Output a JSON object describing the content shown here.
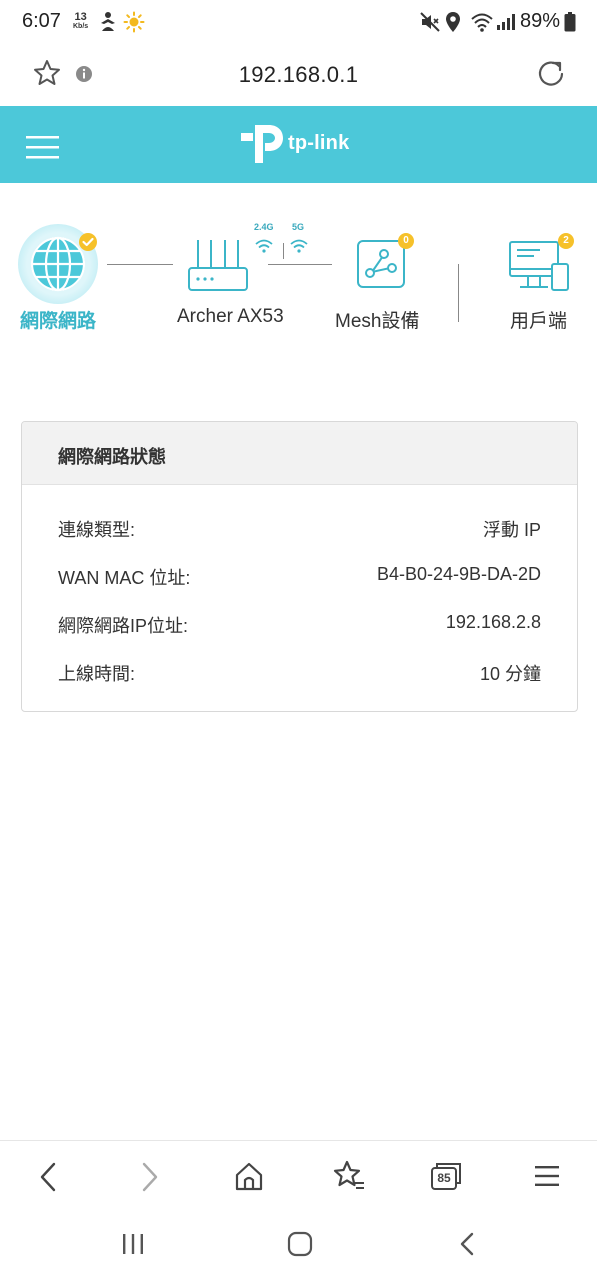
{
  "status_bar": {
    "time": "6:07",
    "net_speed_value": "13",
    "net_speed_unit": "Kb/s",
    "battery": "89%"
  },
  "address_bar": {
    "url": "192.168.0.1"
  },
  "header": {
    "logo_text": "tp-link",
    "accent_color": "#4cc8d9"
  },
  "topology": {
    "internet_label": "網際網路",
    "router_label": "Archer AX53",
    "band_24": "2.4G",
    "band_5": "5G",
    "mesh_label": "Mesh設備",
    "mesh_count": "0",
    "clients_label": "用戶端",
    "clients_count": "2"
  },
  "status_card": {
    "title": "網際網路狀態",
    "rows": [
      {
        "label": "連線類型:",
        "value": "浮動 IP"
      },
      {
        "label": "WAN MAC 位址:",
        "value": "B4-B0-24-9B-DA-2D"
      },
      {
        "label": "網際網路IP位址:",
        "value": "192.168.2.8"
      },
      {
        "label": "上線時間:",
        "value": "10 分鐘"
      }
    ]
  },
  "browser_toolbar": {
    "tab_count": "85"
  }
}
